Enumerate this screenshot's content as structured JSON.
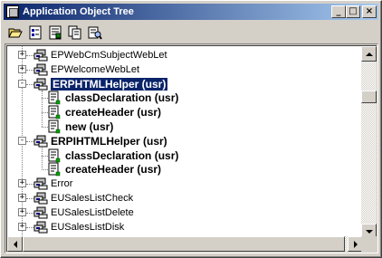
{
  "window": {
    "title": "Application Object Tree",
    "minimize_label": "_",
    "maximize_label": "□",
    "close_label": "×"
  },
  "toolbar": {
    "tools": [
      {
        "name": "open-icon"
      },
      {
        "name": "properties-icon"
      },
      {
        "name": "compile-icon"
      },
      {
        "name": "copy-icon"
      },
      {
        "name": "find-icon"
      }
    ]
  },
  "tree": {
    "nodes": [
      {
        "label": "EPWebCmSubjectWebLet",
        "type": "class",
        "expander": "+"
      },
      {
        "label": "EPWelcomeWebLet",
        "type": "class",
        "expander": "+"
      },
      {
        "label": "ERPHTMLHelper (usr)",
        "type": "class",
        "expander": "−",
        "selected": true,
        "bold": true
      },
      {
        "label": "classDeclaration (usr)",
        "type": "method",
        "bold": true
      },
      {
        "label": "createHeader (usr)",
        "type": "method",
        "bold": true
      },
      {
        "label": "new (usr)",
        "type": "method",
        "bold": true
      },
      {
        "label": "ERPIHTMLHelper (usr)",
        "type": "class",
        "expander": "−",
        "bold": true
      },
      {
        "label": "classDeclaration (usr)",
        "type": "method",
        "bold": true
      },
      {
        "label": "createHeader (usr)",
        "type": "method",
        "bold": true
      },
      {
        "label": "Error",
        "type": "class",
        "expander": "+"
      },
      {
        "label": "EUSalesListCheck",
        "type": "class",
        "expander": "+"
      },
      {
        "label": "EUSalesListDelete",
        "type": "class",
        "expander": "+"
      },
      {
        "label": "EUSalesListDisk",
        "type": "class",
        "expander": "+"
      }
    ]
  },
  "colors": {
    "title_start": "#0a246a",
    "title_end": "#a6caf0",
    "selection": "#0a246a",
    "face": "#d4d0c8"
  }
}
